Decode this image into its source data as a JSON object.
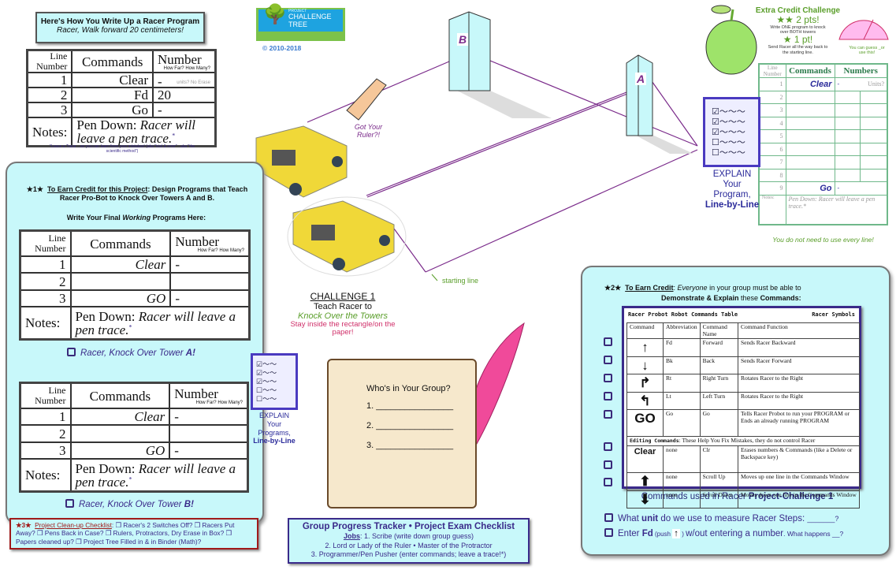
{
  "example": {
    "title": "Here's How You Write Up a Racer Program",
    "subtitle": "Racer, Walk forward 20 centimeters!",
    "headers": {
      "line": "Line Number",
      "commands": "Commands",
      "number": "Number",
      "number_hint": "How Far? How Many?",
      "units": "units? No Erase"
    },
    "rows": [
      {
        "n": "1",
        "cmd": "Clear",
        "val": "-"
      },
      {
        "n": "2",
        "cmd": "Fd",
        "val": "20"
      },
      {
        "n": "3",
        "cmd": "Go",
        "val": "-"
      }
    ],
    "notes_label": "Notes:",
    "notes_prefix": "Pen Down: ",
    "notes_text": "Racer will leave a pen trace.",
    "star": "*",
    "footnote": "*Leave a Trace ...so you can learn from your mistakes! (aka \"trial & error\" - aka \"the scientific method\")"
  },
  "logo": {
    "project": "PROJECT",
    "name1": "CHALLENGE",
    "name2": "TREE",
    "copyright": "© 2010-2018"
  },
  "panel1": {
    "star": "★1★",
    "heading_u": "To Earn Credit for this Project",
    "heading_rest": ": Design Programs that Teach Racer Pro-Bot to Knock Over Towers A and B.",
    "write_pre": "Write Your Final ",
    "write_em": "Working",
    "write_post": " Programs Here:",
    "table_a": [
      {
        "n": "1",
        "cmd": "Clear",
        "val": "-"
      },
      {
        "n": "2",
        "cmd": "",
        "val": ""
      },
      {
        "n": "3",
        "cmd": "GO",
        "val": "-"
      }
    ],
    "task_a_pre": "Racer, Knock Over Tower ",
    "task_a_bold": "A!",
    "table_b": [
      {
        "n": "1",
        "cmd": "Clear",
        "val": "-"
      },
      {
        "n": "2",
        "cmd": "",
        "val": ""
      },
      {
        "n": "3",
        "cmd": "GO",
        "val": "-"
      }
    ],
    "task_b_pre": "Racer, Knock Over Tower ",
    "task_b_bold": "B!"
  },
  "explain_small": {
    "l1": "EXPLAIN",
    "l2": "Your",
    "l3": "Programs,",
    "l4": "Line-by-Line"
  },
  "cleanup": {
    "star": "★3★",
    "title": "Project Clean-up Checklist",
    "text": ": ❒ Racer's 2 Switches Off? ❒ Racers Put Away? ❒ Pens Back in Case? ❒ Rulers, Protractors, Dry Erase in Box? ❒ Papers cleaned up? ❒ Project Tree Filled in & in Binder (Math)?"
  },
  "scene": {
    "tower_a": "A",
    "tower_b": "B",
    "ruler": "Got Your Ruler?!",
    "starting_line": "starting line",
    "challenge": "CHALLENGE 1",
    "teach": "Teach Racer to",
    "knock": "Knock Over the Towers",
    "stay": "Stay inside the rectangle/on the paper!"
  },
  "scroll": {
    "title": "Who's in Your Group?",
    "lines": [
      "1. ________________",
      "2. ________________",
      "3. ________________"
    ]
  },
  "tracker": {
    "title": "Group Progress Tracker • Project Exam Checklist",
    "jobs_label": "Jobs",
    "job1": ": 1. Scribe (write down group guess)",
    "job2": "2. Lord or Lady of the Ruler • Master of the Protractor",
    "job3": "3. Programmer/Pen Pusher (enter commands; leave a trace!*)"
  },
  "extra": {
    "title": "Extra Credit Challenge",
    "two": "★★  2 pts!",
    "two_desc": "Write ONE program to knock over BOTH towers",
    "one": "★  1 pt!",
    "one_desc": "Send Racer all the way back to the starting line.",
    "protractor_note": "You can guess _or use this!",
    "headers": {
      "line": "Line Number",
      "commands": "Commands",
      "numbers": "Numbers",
      "units": "Units?"
    },
    "rows": [
      {
        "n": "1",
        "cmd": "Clear",
        "val": "-"
      },
      {
        "n": "2",
        "cmd": "",
        "val": ""
      },
      {
        "n": "3",
        "cmd": "",
        "val": ""
      },
      {
        "n": "4",
        "cmd": "",
        "val": ""
      },
      {
        "n": "5",
        "cmd": "",
        "val": ""
      },
      {
        "n": "6",
        "cmd": "",
        "val": ""
      },
      {
        "n": "7",
        "cmd": "",
        "val": ""
      },
      {
        "n": "8",
        "cmd": "",
        "val": ""
      },
      {
        "n": "9",
        "cmd": "Go",
        "val": "-"
      }
    ],
    "notes_label": "Notes:",
    "notes_text": "Pen Down: Racer will leave a pen trace.*",
    "footer": "You do not need to use every line!"
  },
  "explain_big": {
    "l1": "EXPLAIN",
    "l2": "Your",
    "l3": "Program,",
    "l4": "Line-by-Line"
  },
  "panel2": {
    "star": "★2★",
    "heading_u": "To Earn Credit",
    "heading_pre": ": ",
    "heading_em": "Everyone",
    "heading_rest": " in your group must be able to",
    "line2_b1": "Demonstrate & Explain",
    "line2_mid": " these ",
    "line2_b2": "Commands:",
    "table_title": "Racer Probot Robot Commands Table",
    "table_symbols": "Racer Symbols",
    "columns": [
      "Command",
      "Abbreviation",
      "Command Name",
      "Command Function"
    ],
    "rows": [
      {
        "sym": "↑",
        "abbr": "Fd",
        "name": "Forward",
        "fn": "Sends Racer Backward"
      },
      {
        "sym": "↓",
        "abbr": "Bk",
        "name": "Back",
        "fn": "Sends Racer Forward"
      },
      {
        "sym": "↱",
        "abbr": "Rt",
        "name": "Right Turn",
        "fn": "Rotates Racer to the Right"
      },
      {
        "sym": "↰",
        "abbr": "Lt",
        "name": "Left Turn",
        "fn": "Rotates Racer to the Right"
      },
      {
        "sym": "GO",
        "abbr": "Go",
        "name": "Go",
        "fn": "Tells Racer Probot to run your PROGRAM or Ends an already running PROGRAM"
      }
    ],
    "editing_label": "Editing Commands",
    "editing_text": ": These Help You Fix Mistakes, they do not control Racer",
    "edit_rows": [
      {
        "sym": "Clear",
        "abbr": "none",
        "name": "Clr",
        "fn": "Erases numbers & Commands (like a Delete or Backspace key)"
      },
      {
        "sym": "⬆",
        "abbr": "none",
        "name": "Scroll Up",
        "fn": "Moves up one line in the Commands Window"
      },
      {
        "sym": "⬇",
        "abbr": "none",
        "name": "Scroll Down",
        "fn": "Moves down one line in the Commands Window"
      }
    ],
    "caption_pre": "Commands used in Racer  ",
    "caption_b": "Project-Challenge 1",
    "q1_pre": "What ",
    "q1_b": "unit",
    "q1_post": " do we use to measure Racer Steps: ",
    "q1_tail": "_______?",
    "q2_pre": "Enter ",
    "q2_b": "Fd",
    "q2_push": " (push ",
    "q2_arrow": "↑",
    "q2_close": " ) ",
    "q2_post": "w/out entering a number",
    "q2_tail": ". What happens __?"
  },
  "colors": {
    "panel": "#c8f8fa",
    "purple": "#3a2a8a",
    "green": "#5a9e2a",
    "pink": "#d0306a",
    "line": "#7a2a8a"
  }
}
